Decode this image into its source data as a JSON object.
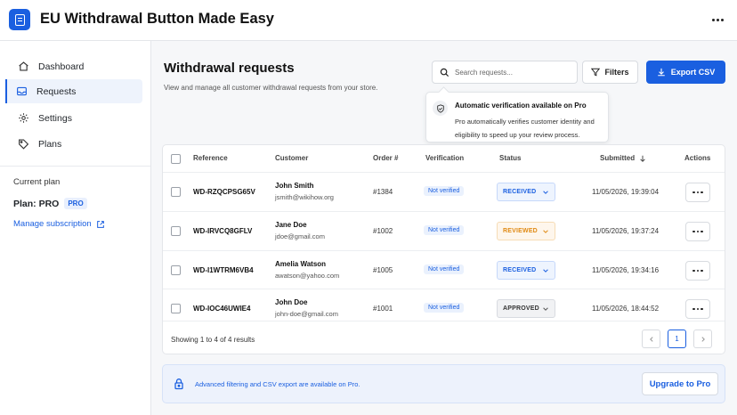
{
  "app": {
    "title": "EU Withdrawal Button Made Easy"
  },
  "sidebar": {
    "items": [
      {
        "label": "Dashboard",
        "icon": "home-icon"
      },
      {
        "label": "Requests",
        "icon": "inbox-icon",
        "active": true
      },
      {
        "label": "Settings",
        "icon": "gear-icon"
      },
      {
        "label": "Plans",
        "icon": "tag-icon"
      }
    ],
    "current_plan_caption": "Current plan",
    "plan_label": "Plan: PRO",
    "plan_badge": "PRO",
    "manage_link": "Manage subscription"
  },
  "main": {
    "title": "Withdrawal requests",
    "subtitle": "View and manage all customer withdrawal requests from your store.",
    "search_placeholder": "Search requests...",
    "filters_label": "Filters",
    "export_label": "Export CSV"
  },
  "tooltip": {
    "title": "Automatic verification available on Pro",
    "body": "Pro automatically verifies customer identity and eligibility to speed up your review process."
  },
  "table": {
    "headers": {
      "reference": "Reference",
      "customer": "Customer",
      "order": "Order #",
      "verification": "Verification",
      "status": "Status",
      "submitted": "Submitted",
      "actions": "Actions"
    },
    "rows": [
      {
        "reference": "WD-RZQCPSG65V",
        "name": "John Smith",
        "email": "jsmith@wikihow.org",
        "order": "#1384",
        "verification": "Not verified",
        "status": "RECEIVED",
        "submitted": "11/05/2026, 19:39:04"
      },
      {
        "reference": "WD-IRVCQ8GFLV",
        "name": "Jane Doe",
        "email": "jdoe@gmail.com",
        "order": "#1002",
        "verification": "Not verified",
        "status": "REVIEWED",
        "submitted": "11/05/2026, 19:37:24"
      },
      {
        "reference": "WD-I1WTRM6VB4",
        "name": "Amelia Watson",
        "email": "awatson@yahoo.com",
        "order": "#1005",
        "verification": "Not verified",
        "status": "RECEIVED",
        "submitted": "11/05/2026, 19:34:16"
      },
      {
        "reference": "WD-IOC46UWIE4",
        "name": "John Doe",
        "email": "john-doe@gmail.com",
        "order": "#1001",
        "verification": "Not verified",
        "status": "APPROVED",
        "submitted": "11/05/2026, 18:44:52"
      }
    ],
    "showing": "Showing 1 to 4 of 4 results",
    "current_page": "1"
  },
  "upsell": {
    "text": "Advanced filtering and CSV export are available on Pro.",
    "button": "Upgrade to Pro"
  },
  "colors": {
    "accent": "#1a5fe0",
    "received": "#1a5fe0",
    "reviewed": "#e08a14",
    "approved": "#333333"
  }
}
